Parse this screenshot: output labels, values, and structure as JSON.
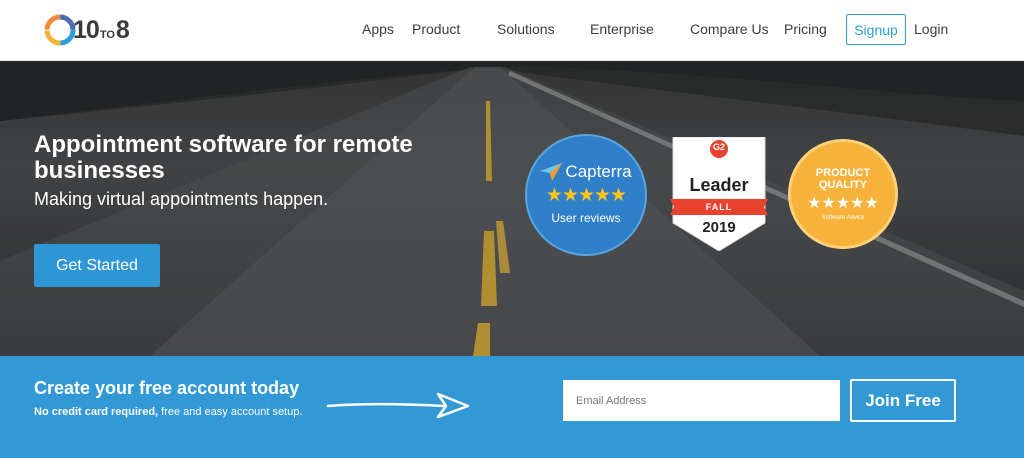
{
  "nav": {
    "logo_main": "10",
    "logo_small": "TO",
    "logo_end": "8",
    "items": [
      "Apps",
      "Product",
      "Solutions",
      "Enterprise",
      "Compare Us",
      "Pricing"
    ],
    "signup_label": "Signup",
    "login_label": "Login"
  },
  "hero": {
    "title": "Appointment software for remote businesses",
    "subtitle": "Making virtual appointments happen.",
    "cta_label": "Get Started",
    "badges": {
      "capterra": {
        "name": "Capterra",
        "stars": "★★★★★",
        "caption": "User reviews"
      },
      "g2": {
        "logo": "G2",
        "title": "Leader",
        "season": "FALL",
        "year": "2019"
      },
      "software_advice": {
        "title": "PRODUCT QUALITY",
        "stars": "★★★★★",
        "footer": "Software Advice"
      }
    }
  },
  "signup_bar": {
    "title": "Create your free account today",
    "sub_bold": "No credit card required,",
    "sub_rest": " free and easy account setup.",
    "email_placeholder": "Email Address",
    "join_label": "Join Free"
  },
  "colors": {
    "accent": "#2f96d6",
    "bar": "#3399d6",
    "star": "#ffc21d",
    "g2_red": "#e8432e",
    "sa_orange": "#f6b23a"
  }
}
